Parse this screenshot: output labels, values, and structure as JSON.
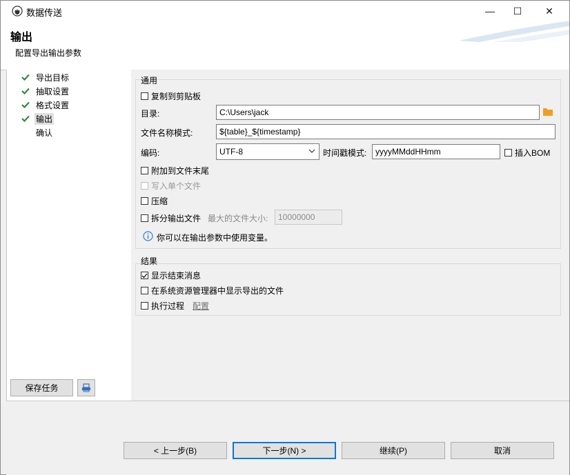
{
  "window": {
    "title": "数据传送",
    "minimize": "—",
    "maximize": "☐",
    "close": "✕"
  },
  "header": {
    "title": "输出",
    "subtitle": "配置导出输出参数"
  },
  "nav": {
    "items": [
      {
        "label": "导出目标",
        "done": true
      },
      {
        "label": "抽取设置",
        "done": true
      },
      {
        "label": "格式设置",
        "done": true
      },
      {
        "label": "输出",
        "done": true,
        "active": true
      },
      {
        "label": "确认",
        "done": false
      }
    ],
    "save_task": "保存任务"
  },
  "general": {
    "title": "通用",
    "copy_clipboard": "复制到剪贴板",
    "dir_label": "目录:",
    "dir_value": "C:\\Users\\jack",
    "filename_label": "文件名称模式:",
    "filename_value": "${table}_${timestamp}",
    "encoding_label": "编码:",
    "encoding_value": "UTF-8",
    "timestamp_label": "时间戳模式:",
    "timestamp_value": "yyyyMMddHHmm",
    "insert_bom": "插入BOM",
    "append": "附加到文件末尾",
    "single_file": "写入单个文件",
    "compress": "压缩",
    "split": "拆分输出文件",
    "max_size_label": "最大的文件大小:",
    "max_size_value": "10000000",
    "info": "你可以在输出参数中使用变量。"
  },
  "results": {
    "title": "结果",
    "show_finish": "显示结束消息",
    "show_explorer": "在系统资源管理器中显示导出的文件",
    "exec_process": "执行过程",
    "configure": "配置"
  },
  "footer": {
    "back": "< 上一步(B)",
    "next": "下一步(N) >",
    "continue": "继续(P)",
    "cancel": "取消"
  },
  "colors": {
    "check": "#2e8b3a",
    "folder": "#f0a020",
    "info": "#2f7fd0"
  }
}
